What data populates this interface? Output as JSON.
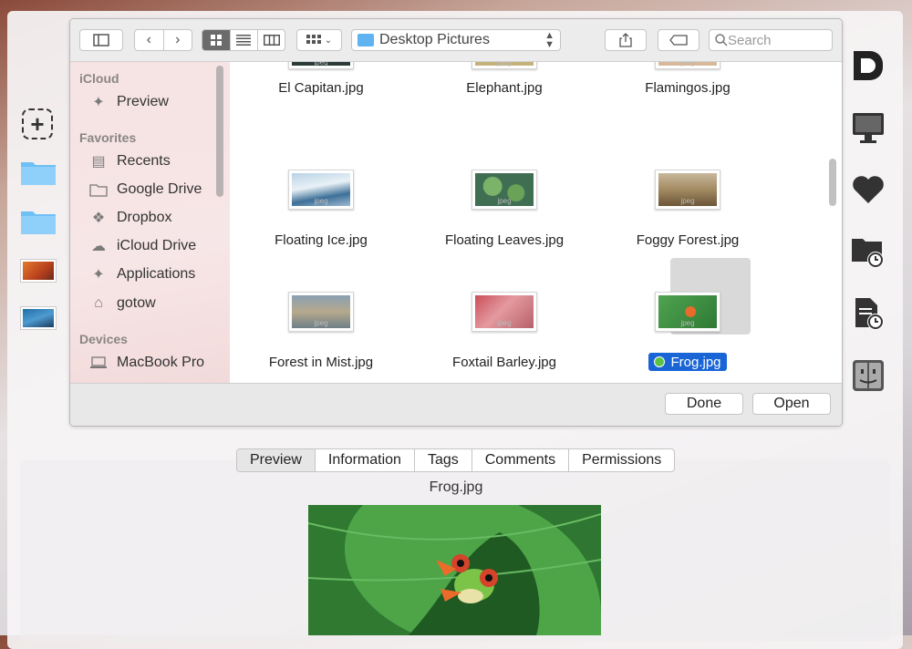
{
  "toolbar": {
    "location": "Desktop Pictures",
    "search_placeholder": "Search"
  },
  "sidebar": {
    "sections": [
      {
        "title": "iCloud",
        "items": [
          {
            "label": "Preview",
            "icon": "app-icon"
          }
        ]
      },
      {
        "title": "Favorites",
        "items": [
          {
            "label": "Recents",
            "icon": "clock-icon"
          },
          {
            "label": "Google Drive",
            "icon": "folder-icon"
          },
          {
            "label": "Dropbox",
            "icon": "dropbox-icon"
          },
          {
            "label": "iCloud Drive",
            "icon": "cloud-icon"
          },
          {
            "label": "Applications",
            "icon": "app-icon"
          },
          {
            "label": "gotow",
            "icon": "home-icon"
          }
        ]
      },
      {
        "title": "Devices",
        "items": [
          {
            "label": "MacBook Pro",
            "icon": "laptop-icon"
          }
        ]
      }
    ]
  },
  "files": [
    {
      "name": "El Capitan.jpg",
      "ext": "jpeg"
    },
    {
      "name": "Elephant.jpg",
      "ext": "jpeg"
    },
    {
      "name": "Flamingos.jpg",
      "ext": "jpeg"
    },
    {
      "name": "Floating Ice.jpg",
      "ext": "jpeg"
    },
    {
      "name": "Floating Leaves.jpg",
      "ext": "jpeg"
    },
    {
      "name": "Foggy Forest.jpg",
      "ext": "jpeg"
    },
    {
      "name": "Forest in Mist.jpg",
      "ext": "jpeg"
    },
    {
      "name": "Foxtail Barley.jpg",
      "ext": "jpeg"
    },
    {
      "name": "Frog.jpg",
      "ext": "jpeg",
      "selected": true
    }
  ],
  "buttons": {
    "done": "Done",
    "open": "Open"
  },
  "inspector": {
    "tabs": [
      "Preview",
      "Information",
      "Tags",
      "Comments",
      "Permissions"
    ],
    "active_tab": "Preview",
    "file_name": "Frog.jpg"
  },
  "colors": {
    "selection": "#1a65d6",
    "tag_green": "#5cc243",
    "folder_blue": "#5fb3f0"
  }
}
